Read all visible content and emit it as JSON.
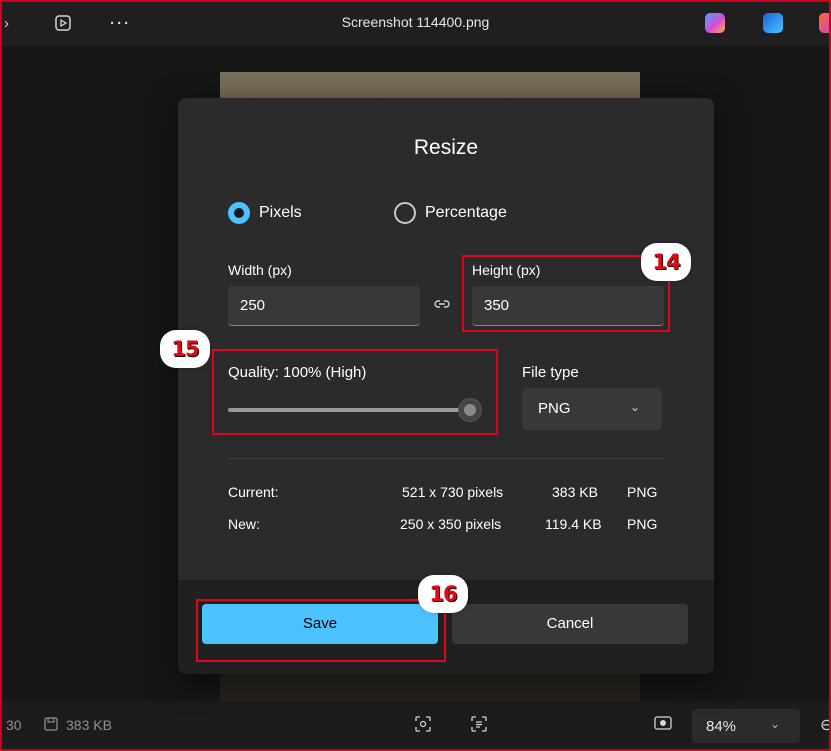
{
  "topbar": {
    "title": "Screenshot 114400.png",
    "icons": [
      "chevron-left-icon",
      "slideshow-icon",
      "more-icon",
      "copilot-icon",
      "designer-icon",
      "office-icon"
    ]
  },
  "dialog": {
    "title": "Resize",
    "mode_options": [
      {
        "label": "Pixels",
        "selected": true
      },
      {
        "label": "Percentage",
        "selected": false
      }
    ],
    "width_label": "Width (px)",
    "width_value": "250",
    "height_label": "Height (px)",
    "height_value": "350",
    "quality_label": "Quality: 100% (High)",
    "quality_percent": 100,
    "file_type_label": "File type",
    "file_type_value": "PNG",
    "current": {
      "label": "Current:",
      "dims": "521 x 730 pixels",
      "size": "383 KB",
      "type": "PNG"
    },
    "new": {
      "label": "New:",
      "dims": "250 x 350 pixels",
      "size": "119.4 KB",
      "type": "PNG"
    },
    "save_label": "Save",
    "cancel_label": "Cancel"
  },
  "bottombar": {
    "left_num": "30",
    "file_size": "383 KB",
    "zoom": "84%"
  },
  "annotations": [
    "14",
    "15",
    "16"
  ],
  "colors": {
    "accent": "#4cc2ff",
    "highlight": "#e0061a"
  }
}
